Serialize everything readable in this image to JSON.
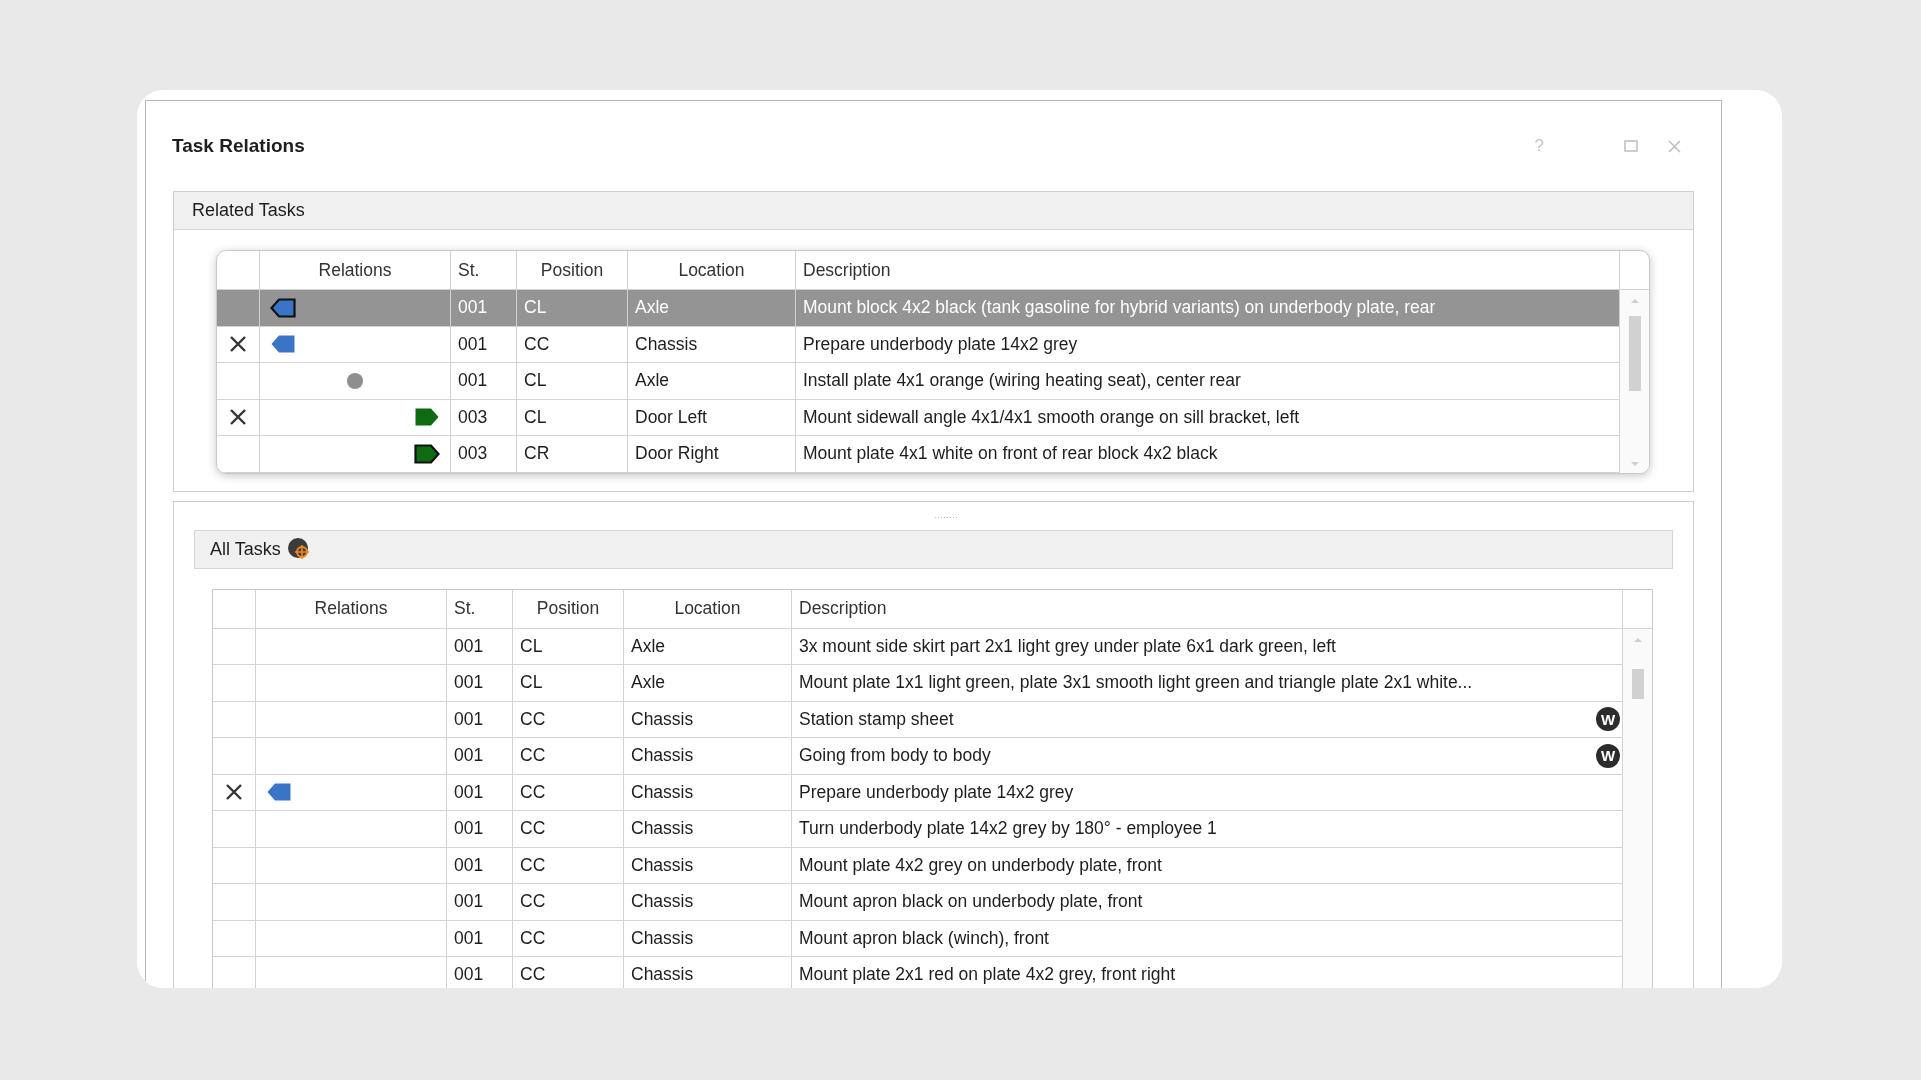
{
  "window": {
    "title": "Task Relations",
    "help": "?"
  },
  "related_tasks": {
    "title": "Related Tasks",
    "columns": [
      "Relations",
      "St.",
      "Position",
      "Location",
      "Description"
    ],
    "rows": [
      {
        "selected": true,
        "marked": false,
        "relation": {
          "kind": "predecessor",
          "outlined": true
        },
        "st": "001",
        "position": "CL",
        "location": "Axle",
        "description": "Mount block 4x2 black (tank gasoline for hybrid variants) on underbody plate, rear"
      },
      {
        "selected": false,
        "marked": true,
        "relation": {
          "kind": "predecessor",
          "outlined": false
        },
        "st": "001",
        "position": "CC",
        "location": "Chassis",
        "description": "Prepare underbody plate 14x2 grey"
      },
      {
        "selected": false,
        "marked": false,
        "relation": {
          "kind": "parallel",
          "outlined": false
        },
        "st": "001",
        "position": "CL",
        "location": "Axle",
        "description": "Install plate 4x1 orange (wiring heating seat), center rear"
      },
      {
        "selected": false,
        "marked": true,
        "relation": {
          "kind": "successor",
          "outlined": false
        },
        "st": "003",
        "position": "CL",
        "location": "Door Left",
        "description": "Mount sidewall angle 4x1/4x1 smooth orange on sill bracket, left"
      },
      {
        "selected": false,
        "marked": false,
        "relation": {
          "kind": "successor",
          "outlined": true
        },
        "st": "003",
        "position": "CR",
        "location": "Door Right",
        "description": "Mount plate 4x1 white on front of rear block 4x2 black"
      }
    ]
  },
  "all_tasks": {
    "title": "All Tasks",
    "columns": [
      "Relations",
      "St.",
      "Position",
      "Location",
      "Description"
    ],
    "rows": [
      {
        "selected": false,
        "marked": false,
        "st": "001",
        "position": "CL",
        "location": "Axle",
        "description": "3x mount side skirt part 2x1 light grey under plate 6x1 dark green, left"
      },
      {
        "selected": false,
        "marked": false,
        "st": "001",
        "position": "CL",
        "location": "Axle",
        "description": "Mount plate 1x1 light green, plate 3x1 smooth light green and triangle plate 2x1 white..."
      },
      {
        "selected": false,
        "marked": false,
        "st": "001",
        "position": "CC",
        "location": "Chassis",
        "description": "Station stamp sheet",
        "badge": "W"
      },
      {
        "selected": false,
        "marked": false,
        "st": "001",
        "position": "CC",
        "location": "Chassis",
        "description": "Going from body to body",
        "badge": "W"
      },
      {
        "selected": false,
        "marked": true,
        "relation": {
          "kind": "predecessor",
          "outlined": false
        },
        "st": "001",
        "position": "CC",
        "location": "Chassis",
        "description": "Prepare underbody plate 14x2 grey"
      },
      {
        "selected": false,
        "marked": false,
        "st": "001",
        "position": "CC",
        "location": "Chassis",
        "description": "Turn underbody plate 14x2 grey by 180° - employee 1"
      },
      {
        "selected": false,
        "marked": false,
        "st": "001",
        "position": "CC",
        "location": "Chassis",
        "description": "Mount plate 4x2 grey on underbody plate, front"
      },
      {
        "selected": false,
        "marked": false,
        "st": "001",
        "position": "CC",
        "location": "Chassis",
        "description": "Mount apron black on underbody plate, front"
      },
      {
        "selected": false,
        "marked": false,
        "st": "001",
        "position": "CC",
        "location": "Chassis",
        "description": "Mount apron black (winch), front"
      },
      {
        "selected": false,
        "marked": false,
        "st": "001",
        "position": "CC",
        "location": "Chassis",
        "description": "Mount plate 2x1 red on plate 4x2 grey, front right"
      }
    ]
  }
}
